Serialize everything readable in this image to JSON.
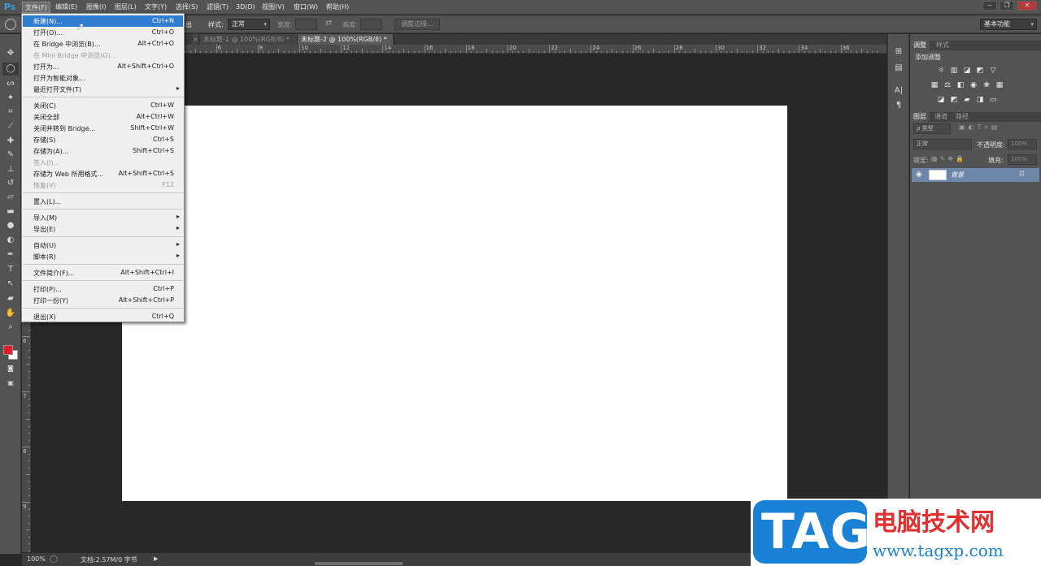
{
  "app": {
    "logo": "Ps"
  },
  "menubar": {
    "items": [
      "文件(F)",
      "编辑(E)",
      "图像(I)",
      "图层(L)",
      "文字(Y)",
      "选择(S)",
      "滤镜(T)",
      "3D(D)",
      "视图(V)",
      "窗口(W)",
      "帮助(H)"
    ],
    "window_buttons": [
      "‒",
      "❐",
      "✕"
    ]
  },
  "options": {
    "partial_label": "出",
    "style_label": "样式:",
    "style_value": "正常",
    "width_label": "宽度:",
    "height_label": "高度:",
    "refine_button": "调整边缘...",
    "workspace": "基本功能"
  },
  "tabs": [
    {
      "label": "未标题-1 @ 100%(RGB/8) *",
      "active": false
    },
    {
      "label": "未标题-2 @ 100%(RGB/8) *",
      "active": true
    }
  ],
  "rulers": {
    "horizontal": [
      "0",
      "2",
      "4",
      "6",
      "8",
      "10",
      "12",
      "14",
      "16",
      "18",
      "20",
      "22",
      "24",
      "26",
      "28",
      "30",
      "32",
      "34",
      "36"
    ],
    "vertical": [
      "1",
      "2",
      "3",
      "4",
      "5",
      "6",
      "7",
      "8",
      "9"
    ]
  },
  "file_menu": {
    "items": [
      {
        "label": "新建(N)...",
        "shortcut": "Ctrl+N",
        "highlighted": true
      },
      {
        "label": "打开(O)...",
        "shortcut": "Ctrl+O"
      },
      {
        "label": "在 Bridge 中浏览(B)...",
        "shortcut": "Alt+Ctrl+O"
      },
      {
        "label": "在 Mini Bridge 中浏览(G)...",
        "shortcut": "",
        "disabled": true
      },
      {
        "label": "打开为...",
        "shortcut": "Alt+Shift+Ctrl+O"
      },
      {
        "label": "打开为智能对象...",
        "shortcut": ""
      },
      {
        "label": "最近打开文件(T)",
        "shortcut": "",
        "submenu": true
      },
      {
        "separator": true
      },
      {
        "label": "关闭(C)",
        "shortcut": "Ctrl+W"
      },
      {
        "label": "关闭全部",
        "shortcut": "Alt+Ctrl+W"
      },
      {
        "label": "关闭并转到 Bridge...",
        "shortcut": "Shift+Ctrl+W"
      },
      {
        "label": "存储(S)",
        "shortcut": "Ctrl+S"
      },
      {
        "label": "存储为(A)...",
        "shortcut": "Shift+Ctrl+S"
      },
      {
        "label": "签入(I)...",
        "shortcut": "",
        "disabled": true
      },
      {
        "label": "存储为 Web 所用格式...",
        "shortcut": "Alt+Shift+Ctrl+S"
      },
      {
        "label": "恢复(V)",
        "shortcut": "F12",
        "disabled": true
      },
      {
        "separator": true
      },
      {
        "label": "置入(L)...",
        "shortcut": ""
      },
      {
        "separator": true
      },
      {
        "label": "导入(M)",
        "shortcut": "",
        "submenu": true
      },
      {
        "label": "导出(E)",
        "shortcut": "",
        "submenu": true
      },
      {
        "separator": true
      },
      {
        "label": "自动(U)",
        "shortcut": "",
        "submenu": true
      },
      {
        "label": "脚本(R)",
        "shortcut": "",
        "submenu": true
      },
      {
        "separator": true
      },
      {
        "label": "文件简介(F)...",
        "shortcut": "Alt+Shift+Ctrl+I"
      },
      {
        "separator": true
      },
      {
        "label": "打印(P)...",
        "shortcut": "Ctrl+P"
      },
      {
        "label": "打印一份(Y)",
        "shortcut": "Alt+Shift+Ctrl+P"
      },
      {
        "separator": true
      },
      {
        "label": "退出(X)",
        "shortcut": "Ctrl+Q"
      }
    ]
  },
  "status": {
    "zoom": "100%",
    "doc_info": "文档:2.57M/0 字节"
  },
  "panels": {
    "adjust_tabs": [
      "调整",
      "样式"
    ],
    "add_adjustment": "添加调整",
    "layer_tabs": [
      "图层",
      "通道",
      "路径"
    ],
    "kind_filter": "ρ 类型",
    "blend_mode": "正常",
    "opacity_label": "不透明度:",
    "opacity_value": "100%",
    "lock_label": "锁定:",
    "fill_label": "填充:",
    "fill_value": "100%",
    "layer_name": "背景"
  },
  "colors": {
    "foreground": "#e8192c",
    "background": "#ffffff",
    "accent": "#2f7dd1"
  },
  "watermark": {
    "badge": "TAG",
    "title": "电脑技术网",
    "url": "www.tagxp.com"
  }
}
